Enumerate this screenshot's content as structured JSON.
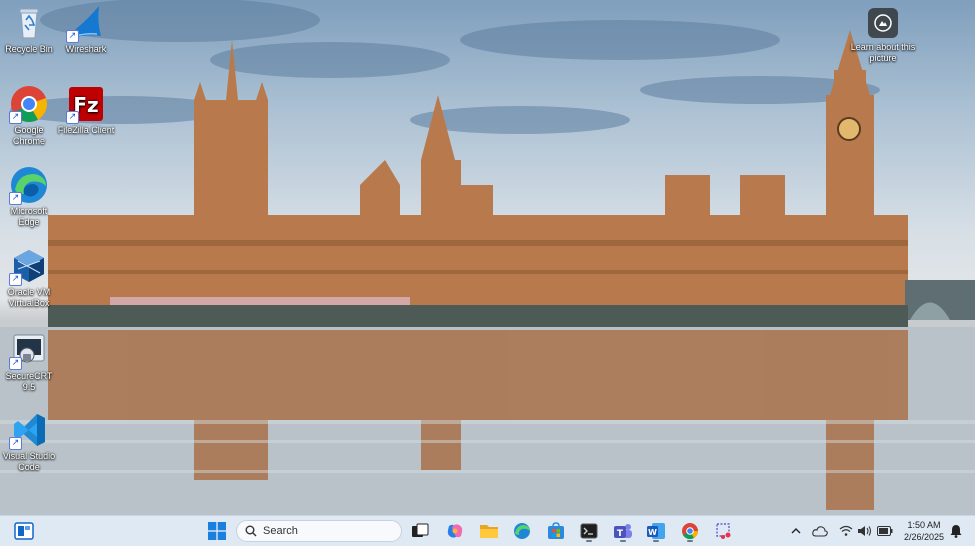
{
  "desktop": {
    "icons": [
      {
        "label": "Recycle Bin",
        "icon": "recycle-bin-icon"
      },
      {
        "label": "Wireshark",
        "icon": "wireshark-icon"
      },
      {
        "label": "Google Chrome",
        "icon": "chrome-icon"
      },
      {
        "label": "FileZilla Client",
        "icon": "filezilla-icon"
      },
      {
        "label": "Microsoft Edge",
        "icon": "edge-icon"
      },
      {
        "label": "Oracle VM VirtualBox",
        "icon": "virtualbox-icon"
      },
      {
        "label": "SecureCRT 9.5",
        "icon": "securecrt-icon"
      },
      {
        "label": "Visual Studio Code",
        "icon": "vscode-icon"
      }
    ],
    "learn_about_picture": "Learn about this picture"
  },
  "taskbar": {
    "search_placeholder": "Search",
    "time": "1:50 AM",
    "date": "2/26/2025",
    "apps": [
      "widgets",
      "start",
      "search",
      "task-view",
      "copilot",
      "file-explorer",
      "edge",
      "microsoft-store",
      "terminal",
      "teams",
      "word",
      "chrome",
      "snipping-tool"
    ]
  },
  "colors": {
    "taskbar_bg": "#dfe9f4",
    "accent": "#0067c0"
  }
}
